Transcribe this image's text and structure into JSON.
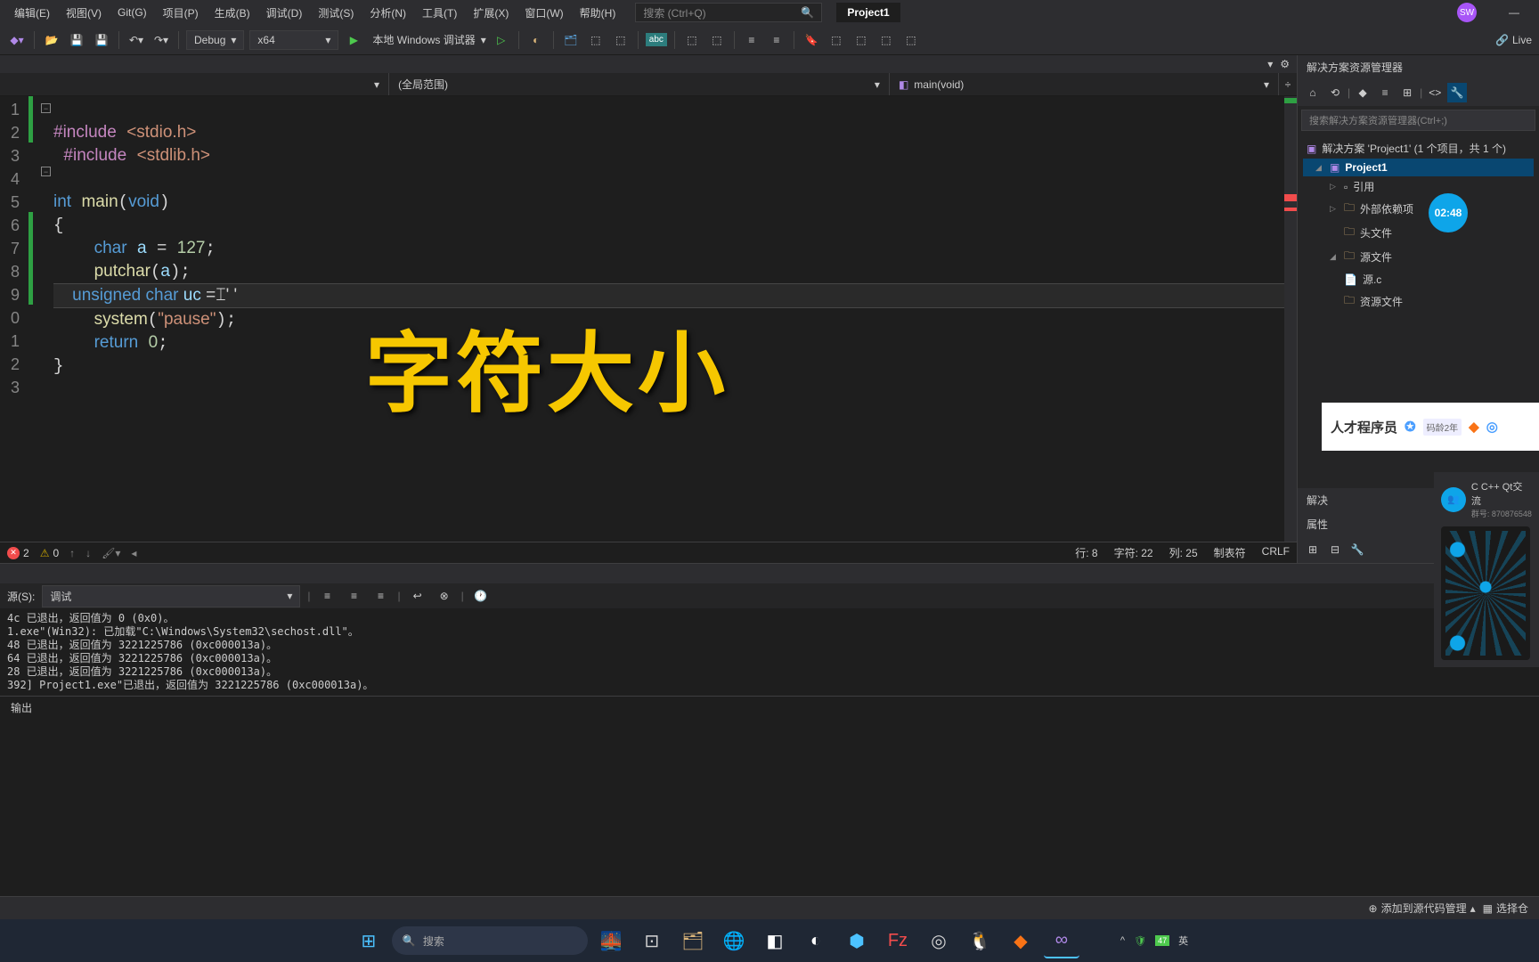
{
  "menubar": {
    "items": [
      "编辑(E)",
      "视图(V)",
      "Git(G)",
      "项目(P)",
      "生成(B)",
      "调试(D)",
      "测试(S)",
      "分析(N)",
      "工具(T)",
      "扩展(X)",
      "窗口(W)",
      "帮助(H)"
    ],
    "search_placeholder": "搜索 (Ctrl+Q)",
    "project_name": "Project1",
    "avatar_initials": "SW"
  },
  "toolbar": {
    "config": "Debug",
    "platform": "x64",
    "debug_target": "本地 Windows 调试器",
    "live_share": "Live"
  },
  "scope": {
    "global": "(全局范围)",
    "function": "main(void)"
  },
  "code": {
    "lines": [
      "1",
      "2",
      "3",
      "4",
      "5",
      "6",
      "7",
      "8",
      "9",
      "0",
      "1",
      "2",
      "3"
    ],
    "l1": "#include <stdio.h>",
    "l2": "#include <stdlib.h>",
    "l4_kw": "int",
    "l4_fn": "main",
    "l4_arg": "void",
    "l6_kw": "char",
    "l6_var": "a",
    "l6_val": "127",
    "l7_fn": "putchar",
    "l7_arg": "a",
    "l8_kw1": "unsigned",
    "l8_kw2": "char",
    "l8_var": "uc",
    "l8_val": "' '",
    "l10_fn": "system",
    "l10_str": "\"pause\"",
    "l11_kw": "return",
    "l11_val": "0"
  },
  "overlay_text": "字符大小",
  "solution": {
    "title": "解决方案资源管理器",
    "search_placeholder": "搜索解决方案资源管理器(Ctrl+;)",
    "root": "解决方案 'Project1' (1 个项目，共 1 个)",
    "project": "Project1",
    "refs": "引用",
    "external": "外部依赖项",
    "headers": "头文件",
    "sources": "源文件",
    "sourcefile": "源.c",
    "resources": "资源文件",
    "timer": "02:48",
    "panel2_prefix": "解决",
    "panel3_prefix": "属性"
  },
  "status": {
    "errors": "2",
    "warnings": "0",
    "line": "行: 8",
    "char": "字符: 22",
    "col": "列: 25",
    "tab": "制表符",
    "eol": "CRLF"
  },
  "output": {
    "source_label": "源(S):",
    "source": "调试",
    "lines": "4c 已退出，返回值为 0 (0x0)。\n1.exe\"(Win32): 已加载\"C:\\Windows\\System32\\sechost.dll\"。\n48 已退出，返回值为 3221225786 (0xc000013a)。\n64 已退出，返回值为 3221225786 (0xc000013a)。\n28 已退出，返回值为 3221225786 (0xc000013a)。\n392] Project1.exe\"已退出，返回值为 3221225786 (0xc000013a)。",
    "tab": "输出"
  },
  "side_card": {
    "name": "人才程序员",
    "badge": "码龄2年"
  },
  "qr_card": {
    "title": "C C++ Qt交流",
    "sub": "群号: 870876548"
  },
  "bottom_status": {
    "vc": "添加到源代码管理",
    "select": "选择仓"
  },
  "taskbar": {
    "search": "搜索",
    "tray_lang": "英",
    "tray_num": "47"
  }
}
